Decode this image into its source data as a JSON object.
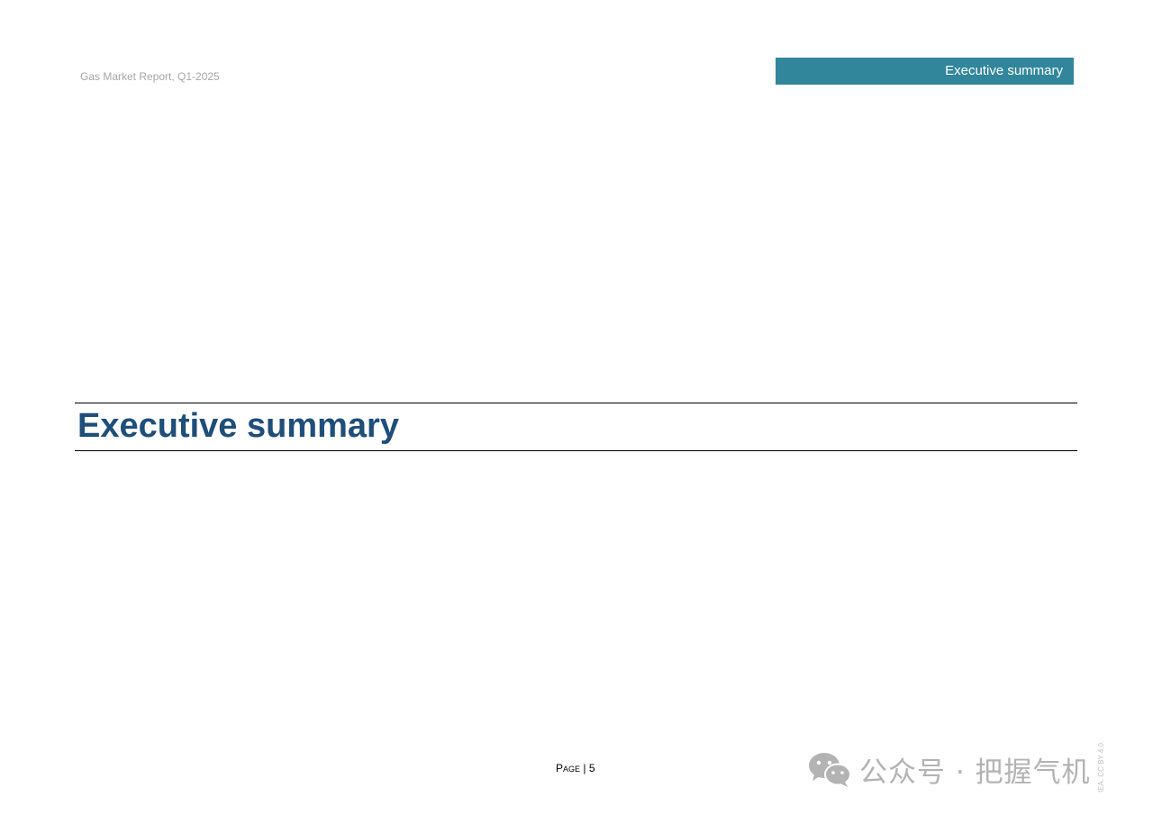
{
  "header": {
    "report_title": "Gas Market Report, Q1-2025",
    "section_tag": "Executive summary"
  },
  "main": {
    "title": "Executive summary"
  },
  "footer": {
    "page_label_first": "P",
    "page_label_rest": "AGE",
    "page_separator": " | ",
    "page_number": "5",
    "license": "IEA. CC BY 4.0."
  },
  "watermark": {
    "icon": "wechat-icon",
    "text": "公众号 · 把握气机"
  },
  "colors": {
    "accent": "#31869b",
    "title": "#1f4e79"
  }
}
